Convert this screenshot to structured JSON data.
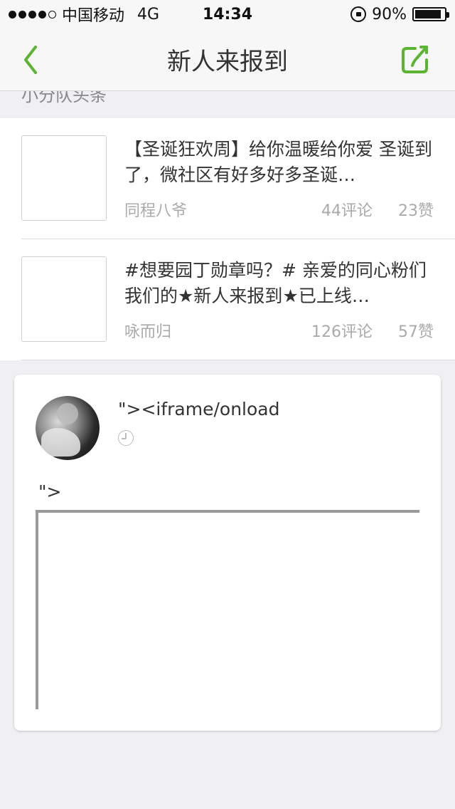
{
  "status_bar": {
    "carrier": "中国移动",
    "network": "4G",
    "time": "14:34",
    "battery_percent": "90%",
    "battery_level": 0.9,
    "signal_bars_filled": 4,
    "signal_bars_total": 5
  },
  "nav": {
    "title": "新人来报到",
    "back_icon": "chevron-left-icon",
    "share_icon": "share-icon",
    "accent_color": "#5bb533"
  },
  "section_header": "小分队头条",
  "articles": [
    {
      "title": "【圣诞狂欢周】给你温暖给你爱 圣诞到了，微社区有好多好多圣诞…",
      "author": "同程八爷",
      "comments": "44评论",
      "likes": "23赞"
    },
    {
      "title": "#想要园丁勋章吗？# 亲爱的同心粉们 我们的★新人来报到★已上线…",
      "author": "咏而归",
      "comments": "126评论",
      "likes": "57赞"
    }
  ],
  "post": {
    "author": "\"><iframe/onload",
    "text": "\">"
  }
}
